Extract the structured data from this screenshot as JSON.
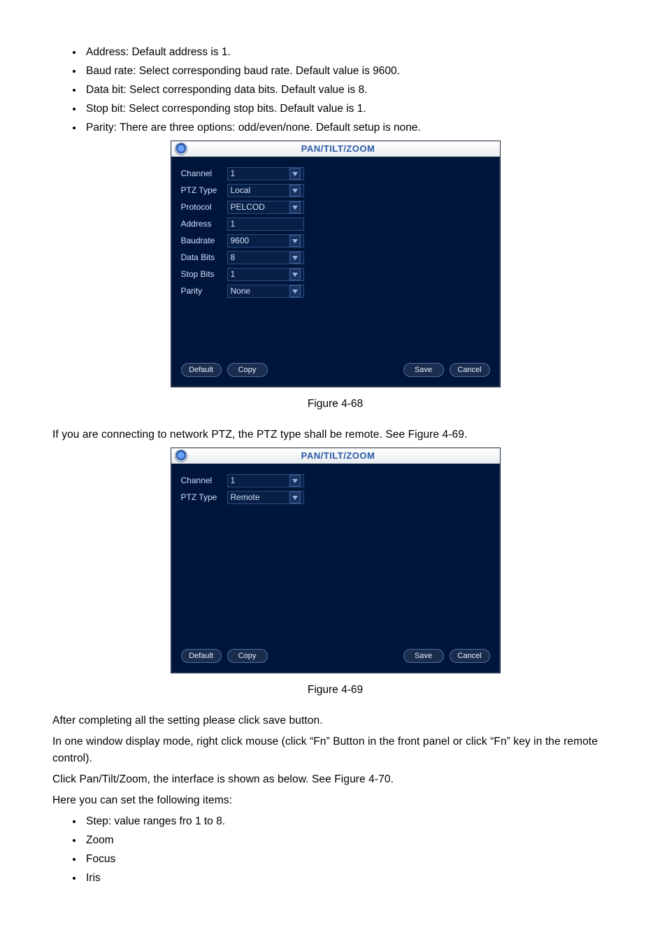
{
  "bullets_top": [
    "Address: Default address is 1.",
    "Baud rate: Select corresponding baud rate. Default value is 9600.",
    "Data bit: Select corresponding data bits. Default value is 8.",
    "Stop bit: Select corresponding stop bits. Default value is 1.",
    "Parity: There are three options: odd/even/none. Default setup is none."
  ],
  "dialog1": {
    "title": "PAN/TILT/ZOOM",
    "fields": {
      "channel": {
        "label": "Channel",
        "value": "1",
        "type": "select"
      },
      "ptztype": {
        "label": "PTZ Type",
        "value": "Local",
        "type": "select"
      },
      "protocol": {
        "label": "Protocol",
        "value": "PELCOD",
        "type": "select"
      },
      "address": {
        "label": "Address",
        "value": "1",
        "type": "text"
      },
      "baudrate": {
        "label": "Baudrate",
        "value": "9600",
        "type": "select"
      },
      "databits": {
        "label": "Data Bits",
        "value": "8",
        "type": "select"
      },
      "stopbits": {
        "label": "Stop Bits",
        "value": "1",
        "type": "select"
      },
      "parity": {
        "label": "Parity",
        "value": "None",
        "type": "select"
      }
    },
    "buttons": {
      "default": "Default",
      "copy": "Copy",
      "save": "Save",
      "cancel": "Cancel"
    }
  },
  "caption1": "Figure 4-68",
  "mid_para": "If you are connecting to network PTZ, the PTZ type shall be remote. See Figure 4-69.",
  "dialog2": {
    "title": "PAN/TILT/ZOOM",
    "fields": {
      "channel": {
        "label": "Channel",
        "value": "1",
        "type": "select"
      },
      "ptztype": {
        "label": "PTZ Type",
        "value": "Remote",
        "type": "select"
      }
    },
    "buttons": {
      "default": "Default",
      "copy": "Copy",
      "save": "Save",
      "cancel": "Cancel"
    }
  },
  "caption2": "Figure 4-69",
  "paras_after": [
    "After completing all the setting please click save button.",
    "In one window display mode, right click mouse (click “Fn” Button in the front panel or click “Fn” key in the remote control).",
    "Click Pan/Tilt/Zoom, the interface is shown as below. See Figure 4-70.",
    "Here you can set the following items:"
  ],
  "bullets_bottom": [
    "Step: value ranges fro 1 to 8.",
    "Zoom",
    "Focus",
    "Iris"
  ]
}
